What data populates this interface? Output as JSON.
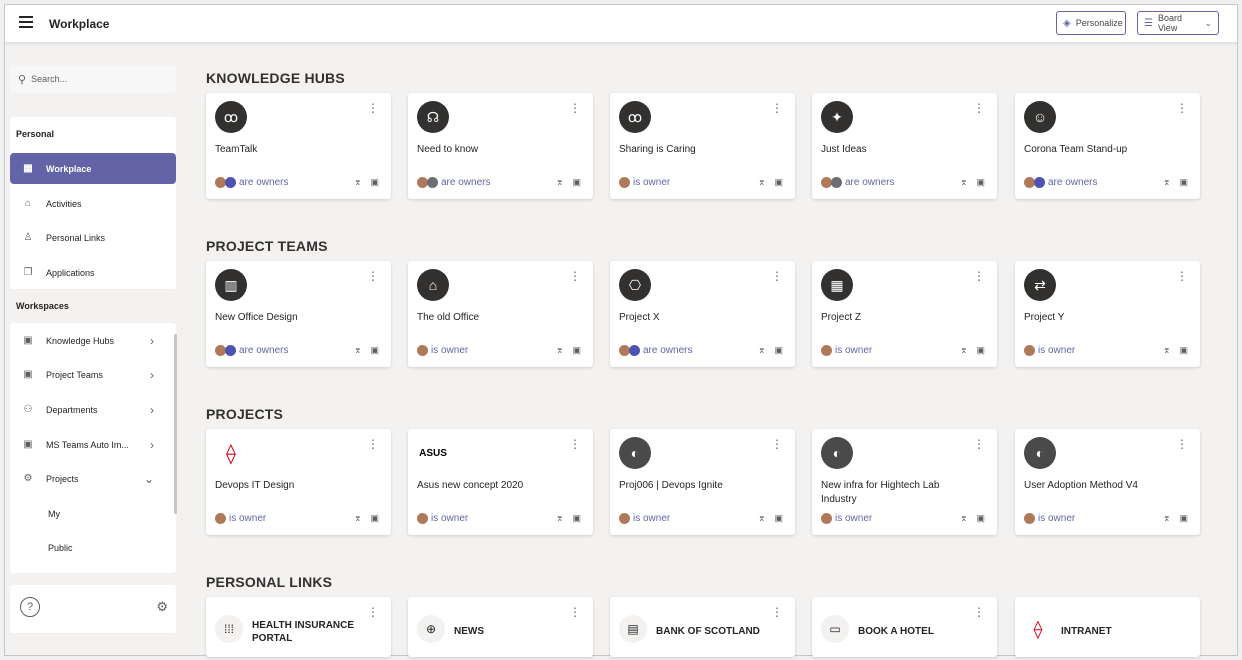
{
  "header": {
    "title": "Workplace",
    "personalize_label": "Personalize",
    "view_label": "Board View"
  },
  "sidebar": {
    "search_placeholder": "Search...",
    "personal_label": "Personal",
    "personal_items": [
      "Workplace",
      "Activities",
      "Personal Links",
      "Applications"
    ],
    "workspaces_label": "Workspaces",
    "workspace_items": [
      "Knowledge Hubs",
      "Project Teams",
      "Departments",
      "MS Teams Auto Im...",
      "Projects"
    ],
    "project_sub_items": [
      "My",
      "Public"
    ]
  },
  "sections": {
    "knowledge_hubs": {
      "title": "KNOWLEDGE HUBS",
      "cards": [
        {
          "name": "TeamTalk",
          "owner": "are owners",
          "icon": "people-icon"
        },
        {
          "name": "Need to know",
          "owner": "are owners",
          "icon": "brain-icon"
        },
        {
          "name": "Sharing is Caring",
          "owner": "is owner",
          "icon": "people-icon"
        },
        {
          "name": "Just Ideas",
          "owner": "are owners",
          "icon": "lightbulb-icon"
        },
        {
          "name": "Corona Team Stand-up",
          "owner": "are owners",
          "icon": "face-mask-icon"
        }
      ]
    },
    "project_teams": {
      "title": "PROJECT TEAMS",
      "cards": [
        {
          "name": "New Office Design",
          "owner": "are owners",
          "icon": "building-icon"
        },
        {
          "name": "The old Office",
          "owner": "is owner",
          "icon": "columns-icon"
        },
        {
          "name": "Project X",
          "owner": "are owners",
          "icon": "flow-icon"
        },
        {
          "name": "Project Z",
          "owner": "is owner",
          "icon": "grid-building-icon"
        },
        {
          "name": "Project Y",
          "owner": "is owner",
          "icon": "exchange-icon"
        }
      ]
    },
    "projects": {
      "title": "PROJECTS",
      "cards": [
        {
          "name": "Devops IT Design",
          "owner": "is owner",
          "icon": "rog-logo"
        },
        {
          "name": "Asus new concept 2020",
          "owner": "is owner",
          "icon": "asus-logo"
        },
        {
          "name": "Proj006 | Devops Ignite",
          "owner": "is owner",
          "icon": "photo-icon"
        },
        {
          "name": "New infra for Hightech Lab Industry",
          "owner": "is owner",
          "icon": "photo-icon"
        },
        {
          "name": "User Adoption Method V4",
          "owner": "is owner",
          "icon": "photo-icon"
        }
      ]
    },
    "personal_links": {
      "title": "PERSONAL LINKS",
      "cards": [
        {
          "name": "HEALTH INSURANCE PORTAL",
          "icon": "dots-grid-icon"
        },
        {
          "name": "NEWS",
          "icon": "globe-search-icon"
        },
        {
          "name": "BANK OF SCOTLAND",
          "icon": "bank-document-icon"
        },
        {
          "name": "BOOK A HOTEL",
          "icon": "browser-icon"
        },
        {
          "name": "INTRANET",
          "icon": "rog-logo"
        }
      ]
    }
  },
  "colors": {
    "accent": "#6264a7",
    "icon_dark": "#323130",
    "rog_red": "#d0021b"
  }
}
